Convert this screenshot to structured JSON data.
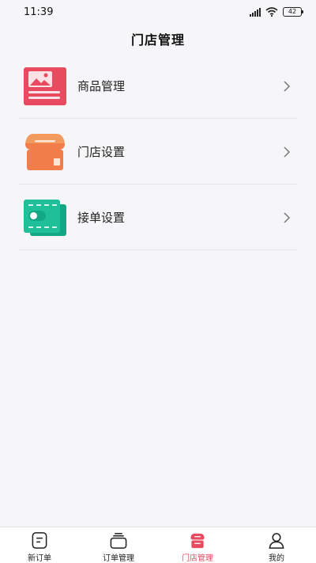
{
  "status_bar": {
    "time": "11:39",
    "battery": "42"
  },
  "header": {
    "title": "门店管理"
  },
  "menu": [
    {
      "label": "商品管理",
      "icon": "product-image-icon",
      "color": "#e84a5f"
    },
    {
      "label": "门店设置",
      "icon": "storefront-icon",
      "color": "#f07d4a"
    },
    {
      "label": "接单设置",
      "icon": "order-toggle-icon",
      "color": "#1fbf9a"
    }
  ],
  "tabbar": {
    "active_color": "#e84a5f",
    "tabs": [
      {
        "label": "新订单",
        "icon": "new-order-icon",
        "active": false
      },
      {
        "label": "订单管理",
        "icon": "order-stack-icon",
        "active": false
      },
      {
        "label": "门店管理",
        "icon": "store-icon",
        "active": true
      },
      {
        "label": "我的",
        "icon": "user-icon",
        "active": false
      }
    ]
  }
}
